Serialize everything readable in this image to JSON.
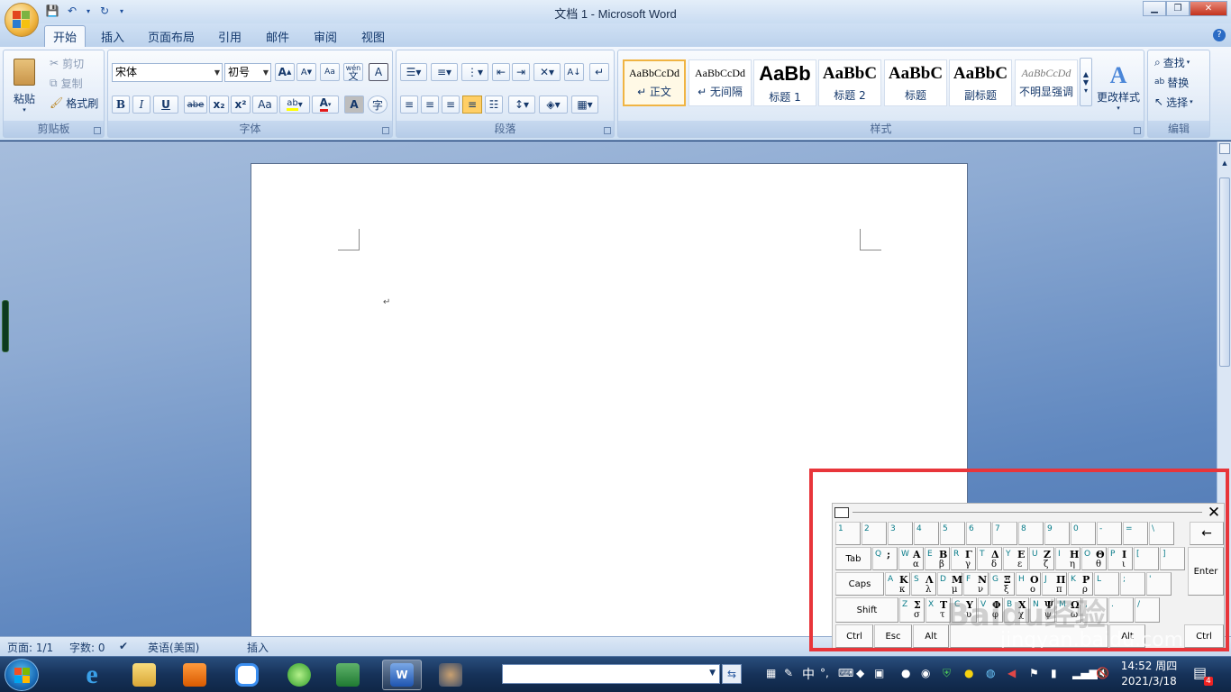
{
  "window": {
    "title": "文档 1 - Microsoft Word"
  },
  "tabs": [
    "开始",
    "插入",
    "页面布局",
    "引用",
    "邮件",
    "审阅",
    "视图"
  ],
  "clipboard": {
    "paste": "粘贴",
    "cut": "剪切",
    "copy": "复制",
    "format_painter": "格式刷",
    "label": "剪贴板"
  },
  "font": {
    "name": "宋体",
    "size": "初号",
    "label": "字体",
    "wen": "wén",
    "wen2": "文",
    "buttons": [
      "B",
      "I",
      "U",
      "abe",
      "x₂",
      "x²",
      "Aa",
      "A",
      "A"
    ]
  },
  "paragraph": {
    "label": "段落"
  },
  "styles": {
    "label": "样式",
    "items": [
      {
        "preview": "AaBbCcDd",
        "name": "↵ 正文"
      },
      {
        "preview": "AaBbCcDd",
        "name": "↵ 无间隔"
      },
      {
        "preview": "AaBb",
        "name": "标题 1"
      },
      {
        "preview": "AaBbC",
        "name": "标题 2"
      },
      {
        "preview": "AaBbC",
        "name": "标题"
      },
      {
        "preview": "AaBbC",
        "name": "副标题"
      },
      {
        "preview": "AaBbCcDd",
        "name": "不明显强调"
      }
    ],
    "change": "更改样式"
  },
  "editing": {
    "find": "查找",
    "replace": "替换",
    "select": "选择",
    "label": "编辑"
  },
  "document": {
    "para_mark": "↵"
  },
  "status": {
    "page": "页面: 1/1",
    "words": "字数: 0",
    "lang": "英语(美国)",
    "mode": "插入"
  },
  "taskbar": {
    "time": "14:52 周四",
    "date": "2021/3/18",
    "ime": "中",
    "badge": "4"
  },
  "keyboard": {
    "row1": [
      "1",
      "2",
      "3",
      "4",
      "5",
      "6",
      "7",
      "8",
      "9",
      "0",
      "-",
      "=",
      "\\"
    ],
    "backspace": "←",
    "tab": "Tab",
    "row2": [
      [
        "Q",
        ";",
        ""
      ],
      [
        "W",
        "Α",
        "α"
      ],
      [
        "E",
        "Β",
        "β"
      ],
      [
        "R",
        "Γ",
        "γ"
      ],
      [
        "T",
        "Δ",
        "δ"
      ],
      [
        "Y",
        "Ε",
        "ε"
      ],
      [
        "U",
        "Ζ",
        "ζ"
      ],
      [
        "I",
        "Η",
        "η"
      ],
      [
        "O",
        "Θ",
        "θ"
      ],
      [
        "P",
        "Ι",
        "ι"
      ],
      [
        "[",
        "",
        ""
      ],
      [
        "]",
        "",
        ""
      ]
    ],
    "caps": "Caps",
    "row3": [
      [
        "A",
        "Κ",
        "κ"
      ],
      [
        "S",
        "Λ",
        "λ"
      ],
      [
        "D",
        "Μ",
        "μ"
      ],
      [
        "F",
        "Ν",
        "ν"
      ],
      [
        "G",
        "Ξ",
        "ξ"
      ],
      [
        "H",
        "Ο",
        "ο"
      ],
      [
        "J",
        "Π",
        "π"
      ],
      [
        "K",
        "Ρ",
        "ρ"
      ],
      [
        "L",
        "",
        ""
      ],
      [
        ";",
        "",
        ""
      ],
      [
        "'",
        "",
        ""
      ]
    ],
    "enter": "Enter",
    "shift": "Shift",
    "row4": [
      [
        "Z",
        "Σ",
        "σ"
      ],
      [
        "X",
        "Τ",
        "τ"
      ],
      [
        "C",
        "Υ",
        "υ"
      ],
      [
        "V",
        "Φ",
        "φ"
      ],
      [
        "B",
        "Χ",
        "χ"
      ],
      [
        "N",
        "Ψ",
        "ψ"
      ],
      [
        "M",
        "Ω",
        "ω"
      ],
      [
        ",",
        "",
        ""
      ],
      [
        ".",
        "",
        ""
      ],
      [
        "/",
        "",
        ""
      ]
    ],
    "ctrl": "Ctrl",
    "esc": "Esc",
    "alt": "Alt"
  },
  "watermark": {
    "logo": "Baidu经验",
    "url": "jingyan.baidu.com"
  }
}
